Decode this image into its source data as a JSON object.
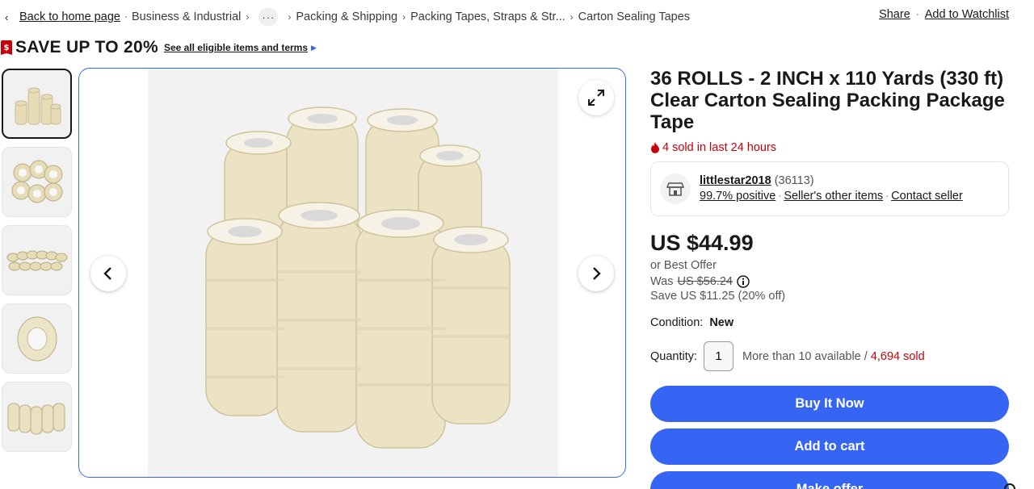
{
  "breadcrumb": {
    "back": "Back to home page",
    "items": [
      "Business & Industrial",
      "Packing & Shipping",
      "Packing Tapes, Straps & Str...",
      "Carton Sealing Tapes"
    ]
  },
  "top_actions": {
    "share": "Share",
    "watchlist": "Add to Watchlist"
  },
  "promo": {
    "title": "SAVE UP TO 20%",
    "link": "See all eligible items and terms"
  },
  "listing": {
    "title": "36 ROLLS - 2 INCH x 110 Yards (330 ft) Clear Carton Sealing Packing Package Tape",
    "sold_recent": "4 sold in last 24 hours"
  },
  "seller": {
    "name": "littlestar2018",
    "feedback": "(36113)",
    "positive": "99.7% positive",
    "other_items": "Seller's other items",
    "contact": "Contact seller"
  },
  "pricing": {
    "price": "US $44.99",
    "best_offer": "or Best Offer",
    "was_label": "Was",
    "was_price": "US $56.24",
    "save": "Save US $11.25 (20% off)"
  },
  "condition": {
    "label": "Condition:",
    "value": "New"
  },
  "quantity": {
    "label": "Quantity:",
    "value": "1",
    "available": "More than 10 available /",
    "sold": "4,694 sold"
  },
  "buttons": {
    "buy_now": "Buy It Now",
    "add_to_cart": "Add to cart",
    "make_offer": "Make offer"
  },
  "colors": {
    "accent": "#3665f3",
    "urgent": "#c7000a",
    "text": "#191919"
  },
  "icons": [
    "chevron-left-icon",
    "chevron-right-icon",
    "more-icon",
    "tag-icon",
    "expand-icon",
    "fire-icon",
    "store-icon",
    "info-icon"
  ]
}
